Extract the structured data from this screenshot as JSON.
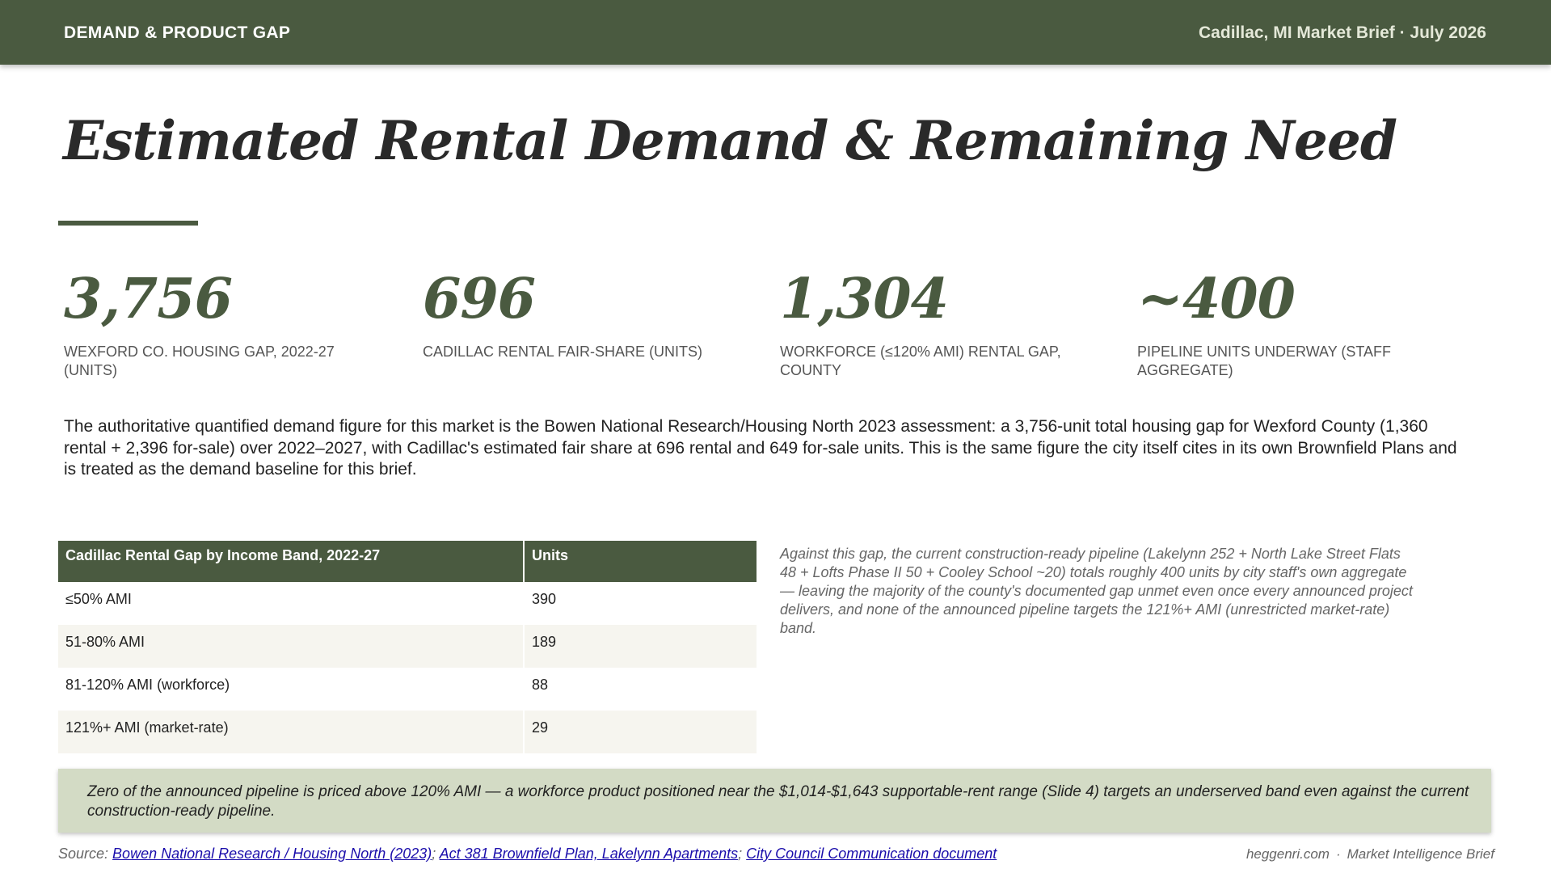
{
  "header": {
    "section": "DEMAND & PRODUCT GAP",
    "brief": "Cadillac, MI Market Brief · July 2026"
  },
  "title": "Estimated Rental Demand & Remaining Need",
  "stats": [
    {
      "value": "3,756",
      "label": "Wexford Co. Housing Gap, 2022-27 (Units)"
    },
    {
      "value": "696",
      "label": "Cadillac Rental Fair-Share (Units)"
    },
    {
      "value": "1,304",
      "label": "Workforce (≤120% AMI) Rental Gap, County"
    },
    {
      "value": "~400",
      "label": "Pipeline Units Underway (Staff Aggregate)"
    }
  ],
  "intro": "The authoritative quantified demand figure for this market is the Bowen National Research/Housing North 2023 assessment: a 3,756-unit total housing gap for Wexford County (1,360 rental + 2,396 for-sale) over 2022–2027, with Cadillac's estimated fair share at 696 rental and 649 for-sale units. This is the same figure the city itself cites in its own Brownfield Plans and is treated as the demand baseline for this brief.",
  "table": {
    "headers": [
      "Cadillac Rental Gap by Income Band, 2022-27",
      "Units"
    ],
    "rows": [
      [
        "≤50% AMI",
        "390"
      ],
      [
        "51-80% AMI",
        "189"
      ],
      [
        "81-120% AMI (workforce)",
        "88"
      ],
      [
        "121%+ AMI (market-rate)",
        "29"
      ]
    ]
  },
  "aside": "Against this gap, the current construction-ready pipeline (Lakelynn 252 + North Lake Street Flats 48 + Lofts Phase II 50 + Cooley School ~20) totals roughly 400 units by city staff's own aggregate — leaving the majority of the county's documented gap unmet even once every announced project delivers, and none of the announced pipeline targets the 121%+ AMI (unrestricted market-rate) band.",
  "callout": "Zero of the announced pipeline is priced above 120% AMI — a workforce product positioned near the $1,014-$1,643 supportable-rent range (Slide 4) targets an underserved band even against the current construction-ready pipeline.",
  "source": {
    "prefix": "Source: ",
    "links": [
      "Bowen National Research / Housing North (2023)",
      "Act 381 Brownfield Plan, Lakelynn Apartments",
      "City Council Communication document"
    ],
    "separator": "; "
  },
  "footer": {
    "site": "heggenri.com",
    "dot": "·",
    "tag": "Market Intelligence Brief"
  },
  "colors": {
    "brand": "#4a5a40",
    "callout_bg": "#d3dbc5",
    "link": "#1a0dab"
  }
}
